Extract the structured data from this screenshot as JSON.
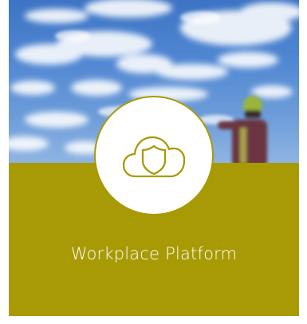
{
  "card": {
    "title": "Workplace Platform",
    "icon": "cloud-shield-icon"
  },
  "colors": {
    "accent": "#a89a05",
    "badge_background": "#ffffff",
    "title_text": "#ffffff",
    "sky": "#4f86d2"
  }
}
